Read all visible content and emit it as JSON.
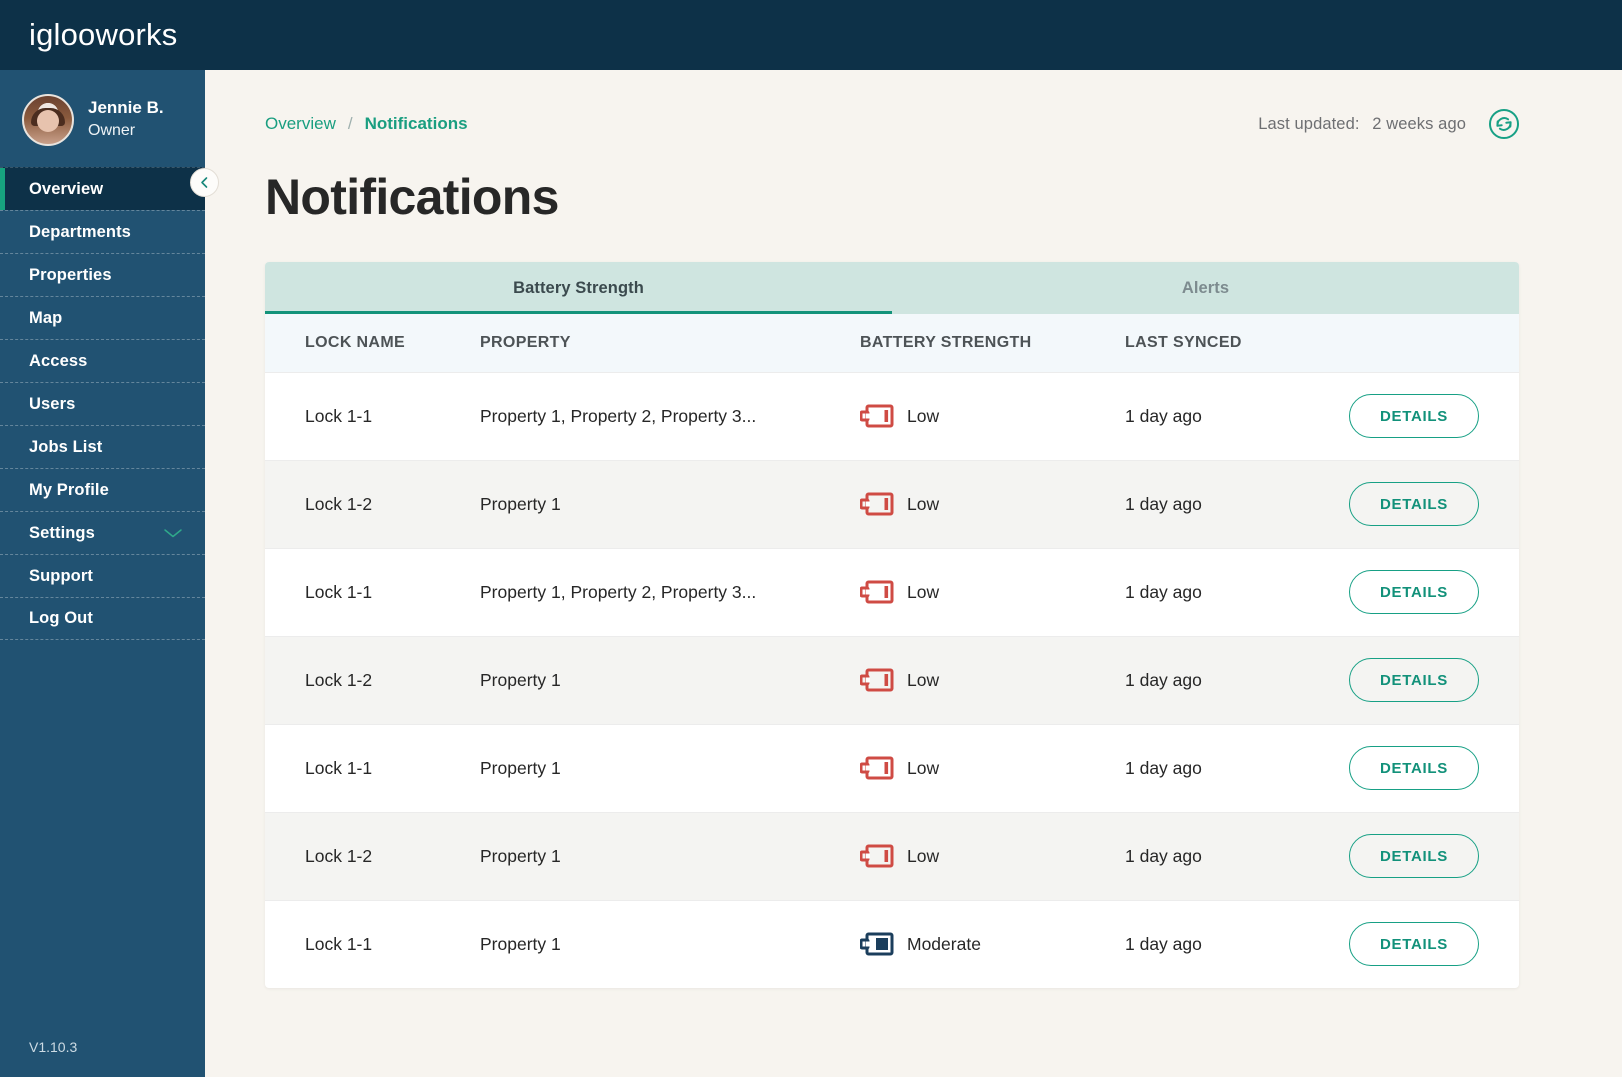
{
  "brand": {
    "name": "iglooworks"
  },
  "sidebar": {
    "profile": {
      "name": "Jennie B.",
      "role": "Owner",
      "avatar_icon": "user-avatar"
    },
    "collapse_icon": "chevron-left-icon",
    "items": [
      {
        "label": "Overview",
        "active": true,
        "expandable": false
      },
      {
        "label": "Departments",
        "active": false,
        "expandable": false
      },
      {
        "label": "Properties",
        "active": false,
        "expandable": false
      },
      {
        "label": "Map",
        "active": false,
        "expandable": false
      },
      {
        "label": "Access",
        "active": false,
        "expandable": false
      },
      {
        "label": "Users",
        "active": false,
        "expandable": false
      },
      {
        "label": "Jobs List",
        "active": false,
        "expandable": false
      },
      {
        "label": "My Profile",
        "active": false,
        "expandable": false
      },
      {
        "label": "Settings",
        "active": false,
        "expandable": true,
        "expand_icon": "chevron-down-icon"
      },
      {
        "label": "Support",
        "active": false,
        "expandable": false
      },
      {
        "label": "Log Out",
        "active": false,
        "expandable": false
      }
    ],
    "version": "V1.10.3"
  },
  "header": {
    "breadcrumb": {
      "parent": "Overview",
      "separator": "/",
      "current": "Notifications"
    },
    "last_updated_label": "Last updated:",
    "last_updated_value": "2 weeks ago",
    "refresh_icon": "refresh-sync-icon",
    "page_title": "Notifications"
  },
  "tabs": [
    {
      "label": "Battery Strength",
      "active": true
    },
    {
      "label": "Alerts",
      "active": false
    }
  ],
  "table": {
    "columns": [
      "LOCK NAME",
      "PROPERTY",
      "BATTERY STRENGTH",
      "LAST SYNCED",
      ""
    ],
    "action_label": "DETAILS",
    "rows": [
      {
        "lock": "Lock 1-1",
        "property": "Property 1, Property 2, Property 3...",
        "battery": "Low",
        "battery_level": "low",
        "synced": "1 day ago"
      },
      {
        "lock": "Lock 1-2",
        "property": "Property 1",
        "battery": "Low",
        "battery_level": "low",
        "synced": "1 day ago"
      },
      {
        "lock": "Lock 1-1",
        "property": "Property 1, Property 2, Property 3...",
        "battery": "Low",
        "battery_level": "low",
        "synced": "1 day ago"
      },
      {
        "lock": "Lock 1-2",
        "property": "Property 1",
        "battery": "Low",
        "battery_level": "low",
        "synced": "1 day ago"
      },
      {
        "lock": "Lock 1-1",
        "property": "Property 1",
        "battery": "Low",
        "battery_level": "low",
        "synced": "1 day ago"
      },
      {
        "lock": "Lock 1-2",
        "property": "Property 1",
        "battery": "Low",
        "battery_level": "low",
        "synced": "1 day ago"
      },
      {
        "lock": "Lock 1-1",
        "property": "Property 1",
        "battery": "Moderate",
        "battery_level": "moderate",
        "synced": "1 day ago"
      }
    ]
  },
  "colors": {
    "brand_dark": "#0d3148",
    "sidebar": "#215272",
    "accent_teal": "#17a085",
    "page_bg": "#f7f4ef",
    "tab_bar": "#cfe5e0",
    "battery_low": "#cf4b44",
    "battery_moderate": "#1b3e5c"
  }
}
